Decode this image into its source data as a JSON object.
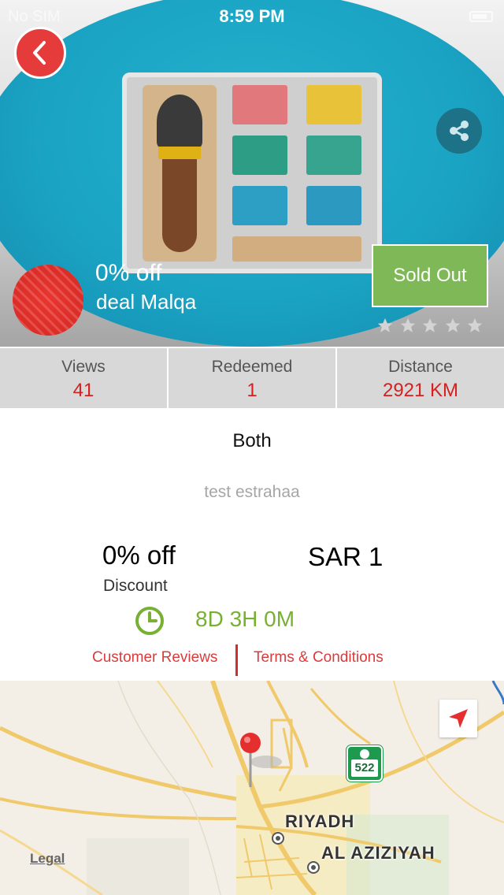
{
  "status_bar": {
    "carrier": "No SIM",
    "time": "8:59 PM"
  },
  "hero": {
    "discount": "0% off",
    "deal_name": "deal Malqa",
    "sold_out_label": "Sold Out",
    "rating": {
      "value": 0,
      "max": 5
    }
  },
  "stats": [
    {
      "label": "Views",
      "value": "41"
    },
    {
      "label": "Redeemed",
      "value": "1"
    },
    {
      "label": "Distance",
      "value": "2921 KM"
    }
  ],
  "details": {
    "type": "Both",
    "description": "test estrahaa",
    "discount_value": "0% off",
    "discount_label": "Discount",
    "price": "SAR 1",
    "time_left": "8D 3H 0M"
  },
  "links": {
    "reviews": "Customer Reviews",
    "terms": "Terms & Conditions"
  },
  "map": {
    "city_label": "RIYADH",
    "area_label": "AL AZIZIYAH",
    "route_number": "522",
    "legal": "Legal"
  },
  "colors": {
    "accent_red": "#d71f1f",
    "sold_out_green": "#7fb857",
    "timer_green": "#78b033",
    "hero_blue": "#1aa3c3"
  }
}
